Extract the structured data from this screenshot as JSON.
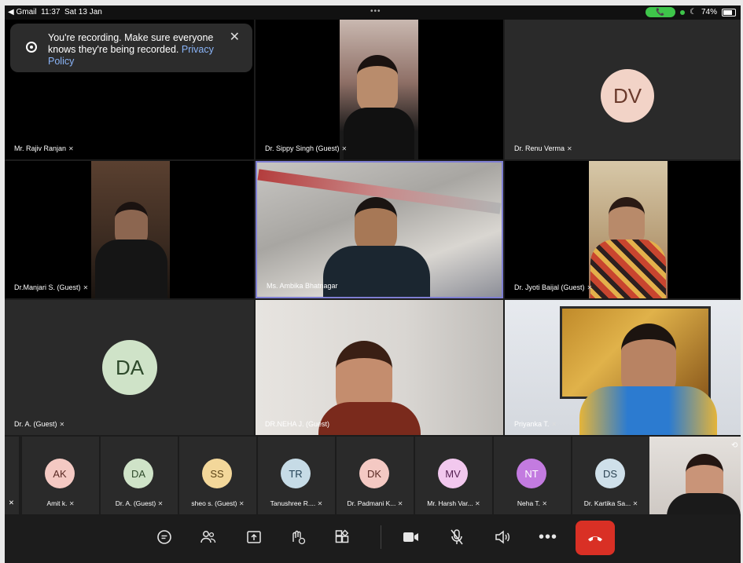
{
  "status_bar": {
    "back_app": "◀ Gmail",
    "time": "11:37",
    "date": "Sat 13 Jan",
    "battery": "74%"
  },
  "banner": {
    "text": "You're recording. Make sure everyone knows they're being recorded.",
    "link": "Privacy Policy"
  },
  "tiles": [
    {
      "name": "Mr. Rajiv Ranjan"
    },
    {
      "name": "Dr. Sippy Singh (Guest)"
    },
    {
      "name": "Dr. Renu Verma",
      "initials": "DV"
    },
    {
      "name": "Dr.Manjari S. (Guest)"
    },
    {
      "name": "Ms. Ambika Bhatnagar"
    },
    {
      "name": "Dr. Jyoti Baijal (Guest)"
    },
    {
      "name": "Dr. A. (Guest)",
      "initials": "DA"
    },
    {
      "name": "DR.NEHA J. (Guest)"
    },
    {
      "name": "Priyanka T."
    }
  ],
  "strip": [
    {
      "initials": "AK",
      "name": "Amit k.",
      "bg": "#f4c9c3",
      "fg": "#5a2a24"
    },
    {
      "initials": "DA",
      "name": "Dr. A. (Guest)",
      "bg": "#cfe3c8",
      "fg": "#2e4a2b"
    },
    {
      "initials": "SS",
      "name": "sheo s. (Guest)",
      "bg": "#f3d79a",
      "fg": "#5a4215"
    },
    {
      "initials": "TR",
      "name": "Tanushree R....",
      "bg": "#c6dbe6",
      "fg": "#234256"
    },
    {
      "initials": "DK",
      "name": "Dr. Padmani K...",
      "bg": "#f4c9c3",
      "fg": "#5a2a24"
    },
    {
      "initials": "MV",
      "name": "Mr. Harsh Var...",
      "bg": "#f2c8ee",
      "fg": "#552052"
    },
    {
      "initials": "NT",
      "name": "Neha T.",
      "bg": "#c37be0",
      "fg": "#ffffff"
    },
    {
      "initials": "DS",
      "name": "Dr. Kartika Sa...",
      "bg": "#cfe0ea",
      "fg": "#2a4252"
    }
  ],
  "colors": {
    "accent_border": "#7f7fd3",
    "end_call": "#d93025",
    "recording_link": "#8ab4f8"
  },
  "icons": [
    "chat-icon",
    "people-icon",
    "present-icon",
    "raise-hand-icon",
    "activities-icon",
    "camera-icon",
    "mic-off-icon",
    "speaker-icon",
    "more-icon",
    "end-call-icon"
  ]
}
